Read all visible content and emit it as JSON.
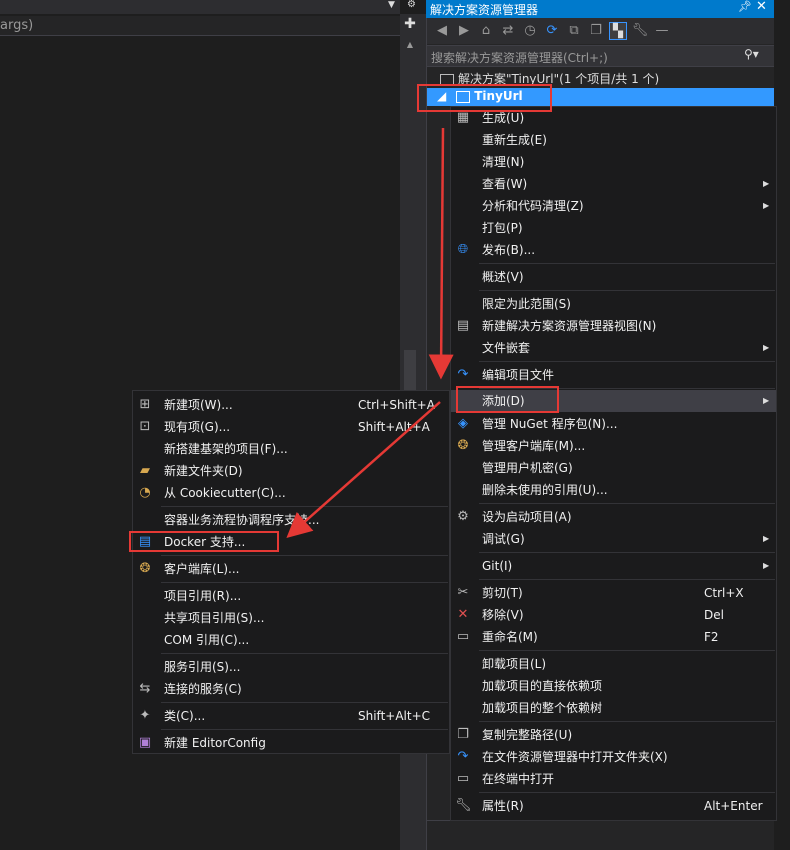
{
  "editor": {
    "args_text": "args)",
    "dropdown_icon": "down-arrow",
    "gear_icon": "gear"
  },
  "solution_explorer": {
    "title": "解决方案资源管理器",
    "search_placeholder": "搜索解决方案资源管理器(Ctrl+;)",
    "solution_label": "解决方案\"TinyUrl\"(1 个项目/共 1 个)",
    "project_label": "TinyUrl"
  },
  "context_menu": {
    "items": [
      {
        "label": "生成(U)"
      },
      {
        "label": "重新生成(E)"
      },
      {
        "label": "清理(N)"
      },
      {
        "label": "查看(W)",
        "submenu": true
      },
      {
        "label": "分析和代码清理(Z)",
        "submenu": true
      },
      {
        "label": "打包(P)"
      },
      {
        "label": "发布(B)..."
      },
      {
        "label": "概述(V)"
      },
      {
        "label": "限定为此范围(S)"
      },
      {
        "label": "新建解决方案资源管理器视图(N)"
      },
      {
        "label": "文件嵌套",
        "submenu": true
      },
      {
        "label": "编辑项目文件"
      },
      {
        "label": "添加(D)",
        "submenu": true,
        "highlighted": true
      },
      {
        "label": "管理 NuGet 程序包(N)..."
      },
      {
        "label": "管理客户端库(M)..."
      },
      {
        "label": "管理用户机密(G)"
      },
      {
        "label": "删除未使用的引用(U)..."
      },
      {
        "label": "设为启动项目(A)"
      },
      {
        "label": "调试(G)",
        "submenu": true
      },
      {
        "label": "Git(I)",
        "submenu": true
      },
      {
        "label": "剪切(T)",
        "shortcut": "Ctrl+X"
      },
      {
        "label": "移除(V)",
        "shortcut": "Del"
      },
      {
        "label": "重命名(M)",
        "shortcut": "F2"
      },
      {
        "label": "卸载项目(L)"
      },
      {
        "label": "加载项目的直接依赖项"
      },
      {
        "label": "加载项目的整个依赖树"
      },
      {
        "label": "复制完整路径(U)"
      },
      {
        "label": "在文件资源管理器中打开文件夹(X)"
      },
      {
        "label": "在终端中打开"
      },
      {
        "label": "属性(R)",
        "shortcut": "Alt+Enter"
      }
    ]
  },
  "add_submenu": {
    "items": [
      {
        "label": "新建项(W)...",
        "shortcut": "Ctrl+Shift+A"
      },
      {
        "label": "现有项(G)...",
        "shortcut": "Shift+Alt+A"
      },
      {
        "label": "新搭建基架的项目(F)..."
      },
      {
        "label": "新建文件夹(D)"
      },
      {
        "label": "从 Cookiecutter(C)..."
      },
      {
        "label": "容器业务流程协调程序支持..."
      },
      {
        "label": "Docker 支持..."
      },
      {
        "label": "客户端库(L)..."
      },
      {
        "label": "项目引用(R)..."
      },
      {
        "label": "共享项目引用(S)..."
      },
      {
        "label": "COM 引用(C)..."
      },
      {
        "label": "服务引用(S)..."
      },
      {
        "label": "连接的服务(C)"
      },
      {
        "label": "类(C)...",
        "shortcut": "Shift+Alt+C"
      },
      {
        "label": "新建 EditorConfig"
      }
    ]
  },
  "colors": {
    "accent": "#007acc",
    "selection": "#3399ff",
    "annotation": "#e53935",
    "menu_bg": "#1b1b1c"
  }
}
